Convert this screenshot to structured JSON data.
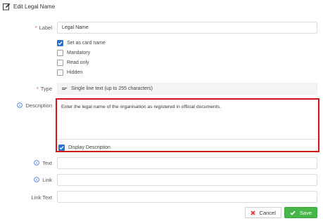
{
  "header": {
    "title": "Edit Legal Name",
    "icon": "edit-icon"
  },
  "form": {
    "label": {
      "label": "Label",
      "value": "Legal Name"
    },
    "options": [
      {
        "label": "Set as card name",
        "checked": true
      },
      {
        "label": "Mandatory",
        "checked": false
      },
      {
        "label": "Read only",
        "checked": false
      },
      {
        "label": "Hidden",
        "checked": false
      }
    ],
    "type": {
      "label": "Type",
      "value": "Single line text (up to 255 characters)",
      "icon": "lines-icon"
    },
    "description": {
      "label": "Description",
      "value": "Enter the legal name of the organisation as registered in official documents.",
      "display_label": "Display Description",
      "display_checked": true
    },
    "text": {
      "label": "Text",
      "value": ""
    },
    "link": {
      "label": "Link",
      "value": ""
    },
    "link_text": {
      "label": "Link Text",
      "value": ""
    }
  },
  "footer": {
    "cancel_label": "Cancel",
    "save_label": "Save"
  },
  "colors": {
    "accent": "#2f6fd1",
    "highlight_border": "#d9111b",
    "save": "#46b649",
    "cancel_icon": "#e0312a",
    "required": "#d9534f"
  }
}
